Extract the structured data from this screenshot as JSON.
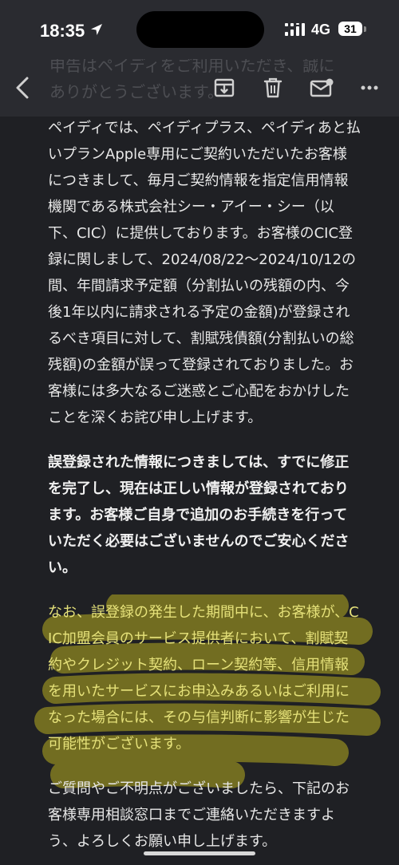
{
  "status_bar": {
    "time": "18:35",
    "network": "4G",
    "battery": "31"
  },
  "toolbar": {
    "ghost_line1": "申告はペイディをご利用いただき、誠に",
    "ghost_line2": "ありがとうございます。"
  },
  "body": {
    "paragraph1": "ペイディでは、ペイディプラス、ペイディあと払いプランApple専用にご契約いただいたお客様につきまして、毎月ご契約情報を指定信用情報機関である株式会社シー・アイー・シー（以下、CIC）に提供しております。お客様のCIC登録に関しまして、2024/08/22〜2024/10/12の間、年間請求予定額（分割払いの残額の内、今後1年以内に請求される予定の金額)が登録されるべき項目に対して、割賦残債額(分割払いの総残額)の金額が誤って登録されておりました。お客様には多大なるご迷惑とご心配をおかけしたことを深くお詫び申し上げます。",
    "paragraph2": "誤登録された情報につきましては、すでに修正を完了し、現在は正しい情報が登録されております。お客様ご自身で追加のお手続きを行っていただく必要はございませんのでご安心ください。",
    "paragraph3": "なお、誤登録の発生した期間中に、お客様が、CIC加盟会員のサービス提供者において、割賦契約やクレジット契約、ローン契約等、信用情報を用いたサービスにお申込みあるいはご利用になった場合には、その与信判断に影響が生じた可能性がございます。",
    "paragraph4": "ご質問やご不明点がございましたら、下記のお客様専用相談窓口までご連絡いただきますよう、よろしくお願い申し上げます。"
  },
  "colors": {
    "background": "#1f2024",
    "bar": "#2a2b30",
    "highlight": "#c8c02a",
    "highlight_text": "#e6e27a"
  }
}
